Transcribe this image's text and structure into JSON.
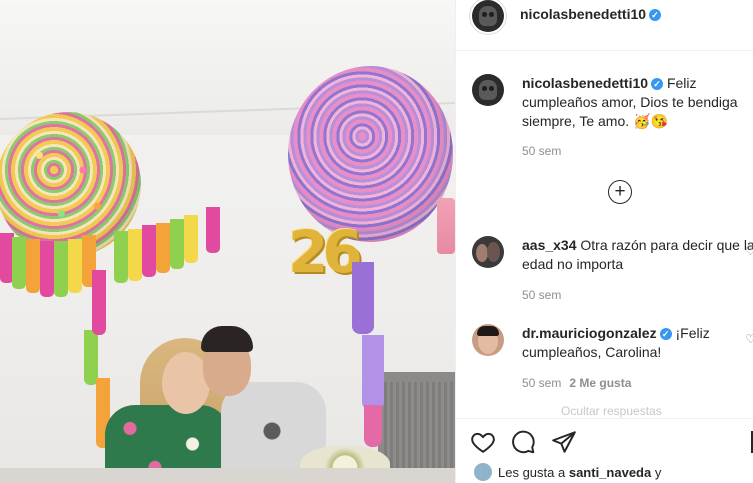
{
  "colors": {
    "verified": "#3897f0",
    "text": "#262626",
    "muted": "#8e8e8e",
    "border": "#efefef"
  },
  "header": {
    "username": "nicolasbenedetti10",
    "verified_glyph": "✓"
  },
  "caption": {
    "username": "nicolasbenedetti10",
    "text": "Feliz cumpleaños amor, Dios te bendiga siempre, Te amo. 🥳😘",
    "time": "50 sem"
  },
  "load_more": {
    "glyph": "+"
  },
  "comments": [
    {
      "username": "aas_x34",
      "verified": false,
      "text": "Otra razón para decir que la edad no importa",
      "time": "50 sem",
      "likes": ""
    },
    {
      "username": "dr.mauriciogonzalez",
      "verified": true,
      "text": "¡Feliz cumpleaños, Carolina!",
      "time": "50 sem",
      "likes": "2 Me gusta"
    }
  ],
  "faded_row": {
    "text": "Ocultar respuestas"
  },
  "photo": {
    "balloon_number": "26"
  },
  "actions": {
    "like_icon": "heart-icon",
    "comment_icon": "comment-icon",
    "share_icon": "share-icon"
  },
  "likes_line": {
    "prefix": "Les gusta a",
    "user": "santi_naveda",
    "suffix": "y"
  }
}
